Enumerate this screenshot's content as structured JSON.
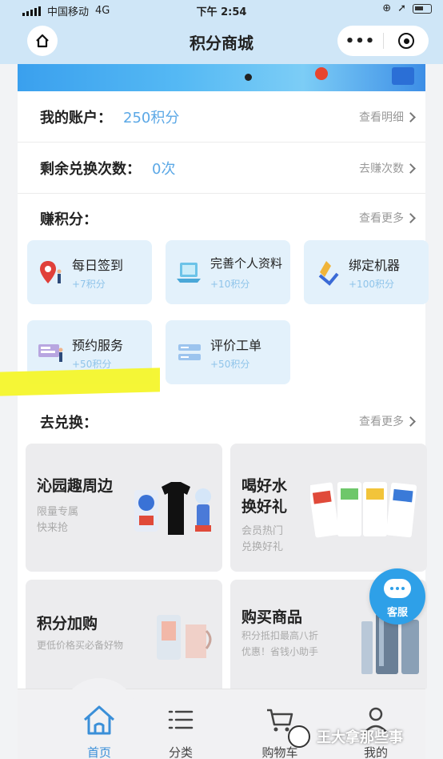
{
  "status_bar": {
    "carrier": "中国移动",
    "network": "4G",
    "time": "下午 2:54"
  },
  "header": {
    "title": "积分商城",
    "home_icon": "home-icon",
    "more_label": "•••"
  },
  "account": {
    "label": "我的账户：",
    "value": "250积分",
    "link": "查看明细"
  },
  "exchange_count": {
    "label": "剩余兑换次数：",
    "value": "0次",
    "link": "去赚次数"
  },
  "earn": {
    "title": "赚积分：",
    "link": "查看更多",
    "tasks": [
      {
        "name": "每日签到",
        "points": "+7积分",
        "icon": "map-pin-icon"
      },
      {
        "name": "完善个人资料",
        "points": "+10积分",
        "icon": "profile-laptop-icon"
      },
      {
        "name": "绑定机器",
        "points": "+100积分",
        "icon": "bind-device-icon"
      },
      {
        "name": "预约服务",
        "points": "+50积分",
        "icon": "service-booking-icon"
      },
      {
        "name": "评价工单",
        "points": "+50积分",
        "icon": "review-order-icon"
      }
    ]
  },
  "redeem": {
    "title": "去兑换：",
    "link": "查看更多",
    "cards": [
      {
        "title": "沁园趣周边",
        "sub1": "限量专属",
        "sub2": "快来抢"
      },
      {
        "title": "喝好水",
        "title2": "换好礼",
        "sub1": "会员热门",
        "sub2": "兑换好礼"
      },
      {
        "title": "积分加购",
        "sub1": "更低价格买必备好物"
      },
      {
        "title": "购买商品",
        "sub1": "积分抵扣最高八折",
        "sub2": "优惠！省钱小助手"
      }
    ]
  },
  "customer_service": {
    "label": "客服"
  },
  "tabbar": {
    "items": [
      {
        "label": "首页",
        "icon": "home-icon",
        "active": true
      },
      {
        "label": "分类",
        "icon": "category-icon",
        "active": false
      },
      {
        "label": "购物车",
        "icon": "cart-icon",
        "active": false
      },
      {
        "label": "我的",
        "icon": "user-icon",
        "active": false
      }
    ]
  },
  "watermark": {
    "text": "王大拿那些事"
  },
  "colors": {
    "header_bg": "#cfe6f7",
    "accent": "#5ba8e6",
    "task_bg": "#e3f1fb",
    "card_bg": "#ececee",
    "highlight": "#f4f52b",
    "service_button": "#2ea0e8"
  }
}
